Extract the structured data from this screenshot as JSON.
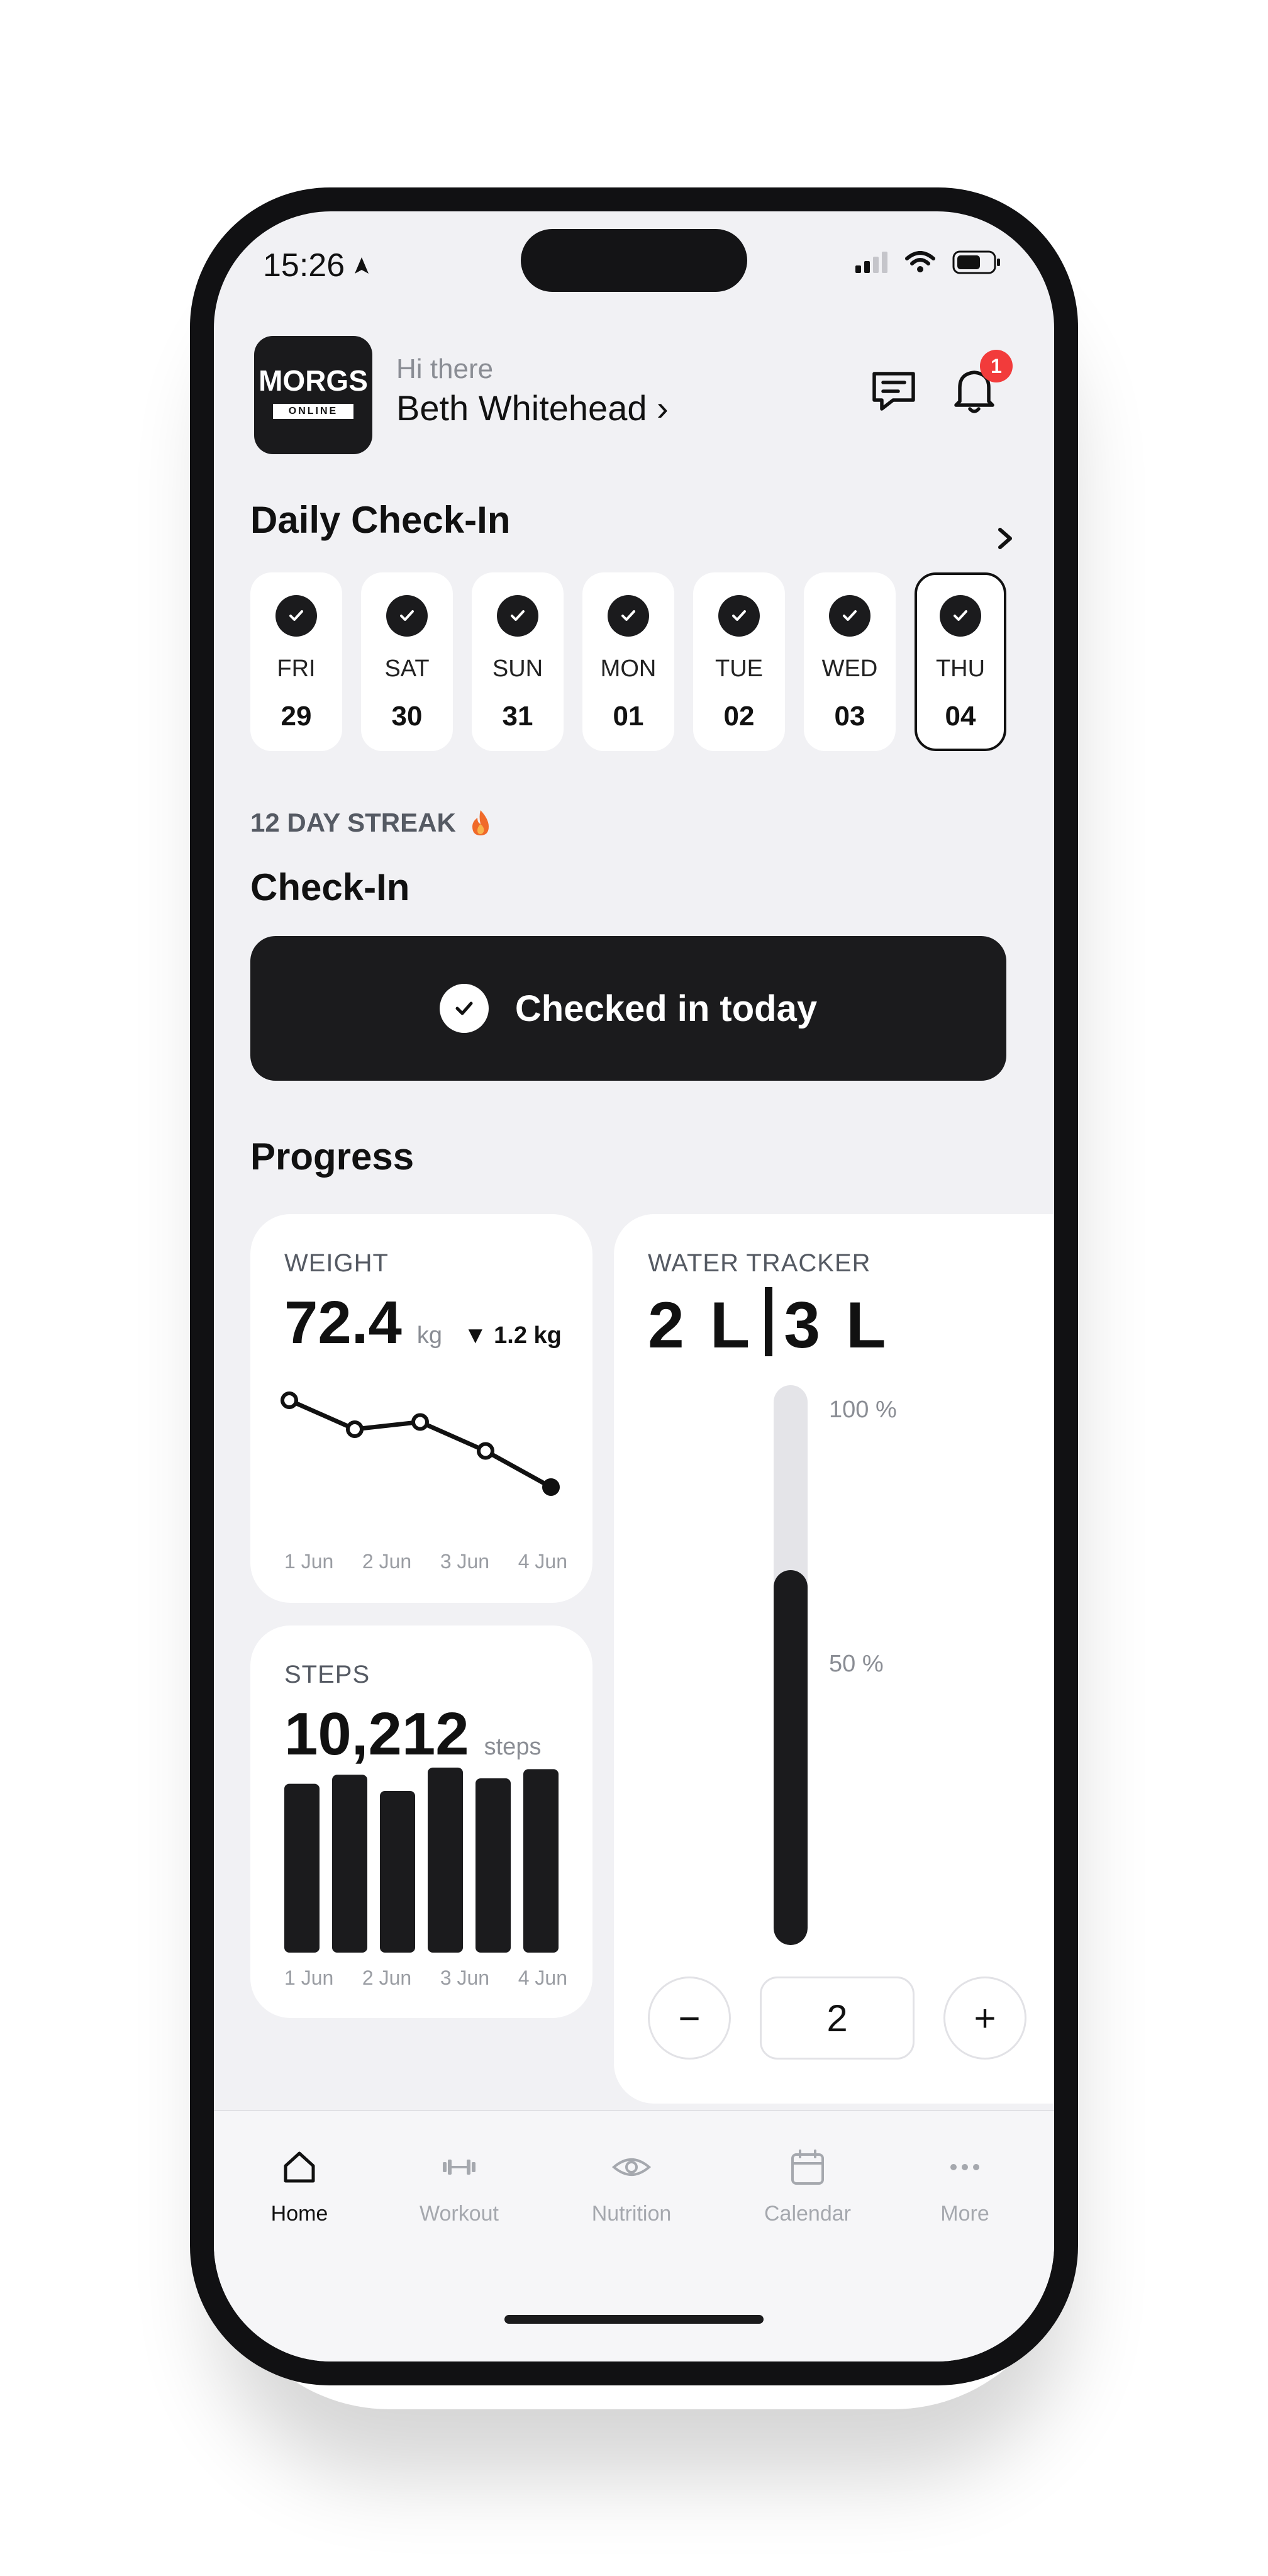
{
  "status_bar": {
    "time": "15:26"
  },
  "header": {
    "logo_text": "MORGS",
    "logo_subtext": "ONLINE",
    "greeting": "Hi there",
    "user_name": "Beth Whitehead ›",
    "notification_count": "1"
  },
  "daily_checkin": {
    "title": "Daily Check-In",
    "days": [
      {
        "name": "FRI",
        "num": "29"
      },
      {
        "name": "SAT",
        "num": "30"
      },
      {
        "name": "SUN",
        "num": "31"
      },
      {
        "name": "MON",
        "num": "01"
      },
      {
        "name": "TUE",
        "num": "02"
      },
      {
        "name": "WED",
        "num": "03"
      },
      {
        "name": "THU",
        "num": "04"
      }
    ],
    "streak": "12 DAY STREAK"
  },
  "checkin": {
    "title": "Check-In",
    "button_label": "Checked in today"
  },
  "progress": {
    "title": "Progress",
    "weight": {
      "label": "WEIGHT",
      "value": "72.4",
      "unit": "kg",
      "change": "▼ 1.2 kg",
      "x_labels": [
        "1 Jun",
        "2 Jun",
        "3 Jun",
        "4 Jun"
      ],
      "points": [
        73.6,
        73.2,
        73.3,
        72.9,
        72.4
      ]
    },
    "steps": {
      "label": "STEPS",
      "value": "10,212",
      "unit": "steps",
      "x_labels": [
        "1 Jun",
        "2 Jun",
        "3 Jun",
        "4 Jun"
      ],
      "bars": [
        9400,
        9900,
        9000,
        10300,
        9700,
        10212
      ]
    },
    "water": {
      "label": "WATER TRACKER",
      "current": "2 L",
      "goal": "3 L",
      "fill_fraction": 0.67,
      "pct_100": "100 %",
      "pct_50": "50 %",
      "minus": "−",
      "plus": "+",
      "stepper_value": "2"
    }
  },
  "tabbar": {
    "home": "Home",
    "workout": "Workout",
    "nutrition": "Nutrition",
    "calendar": "Calendar",
    "more": "More"
  },
  "colors": {
    "accent": "#1b1b1d",
    "background": "#f1f1f4",
    "badge": "#f23b3b",
    "flame": "#f06a2a"
  }
}
